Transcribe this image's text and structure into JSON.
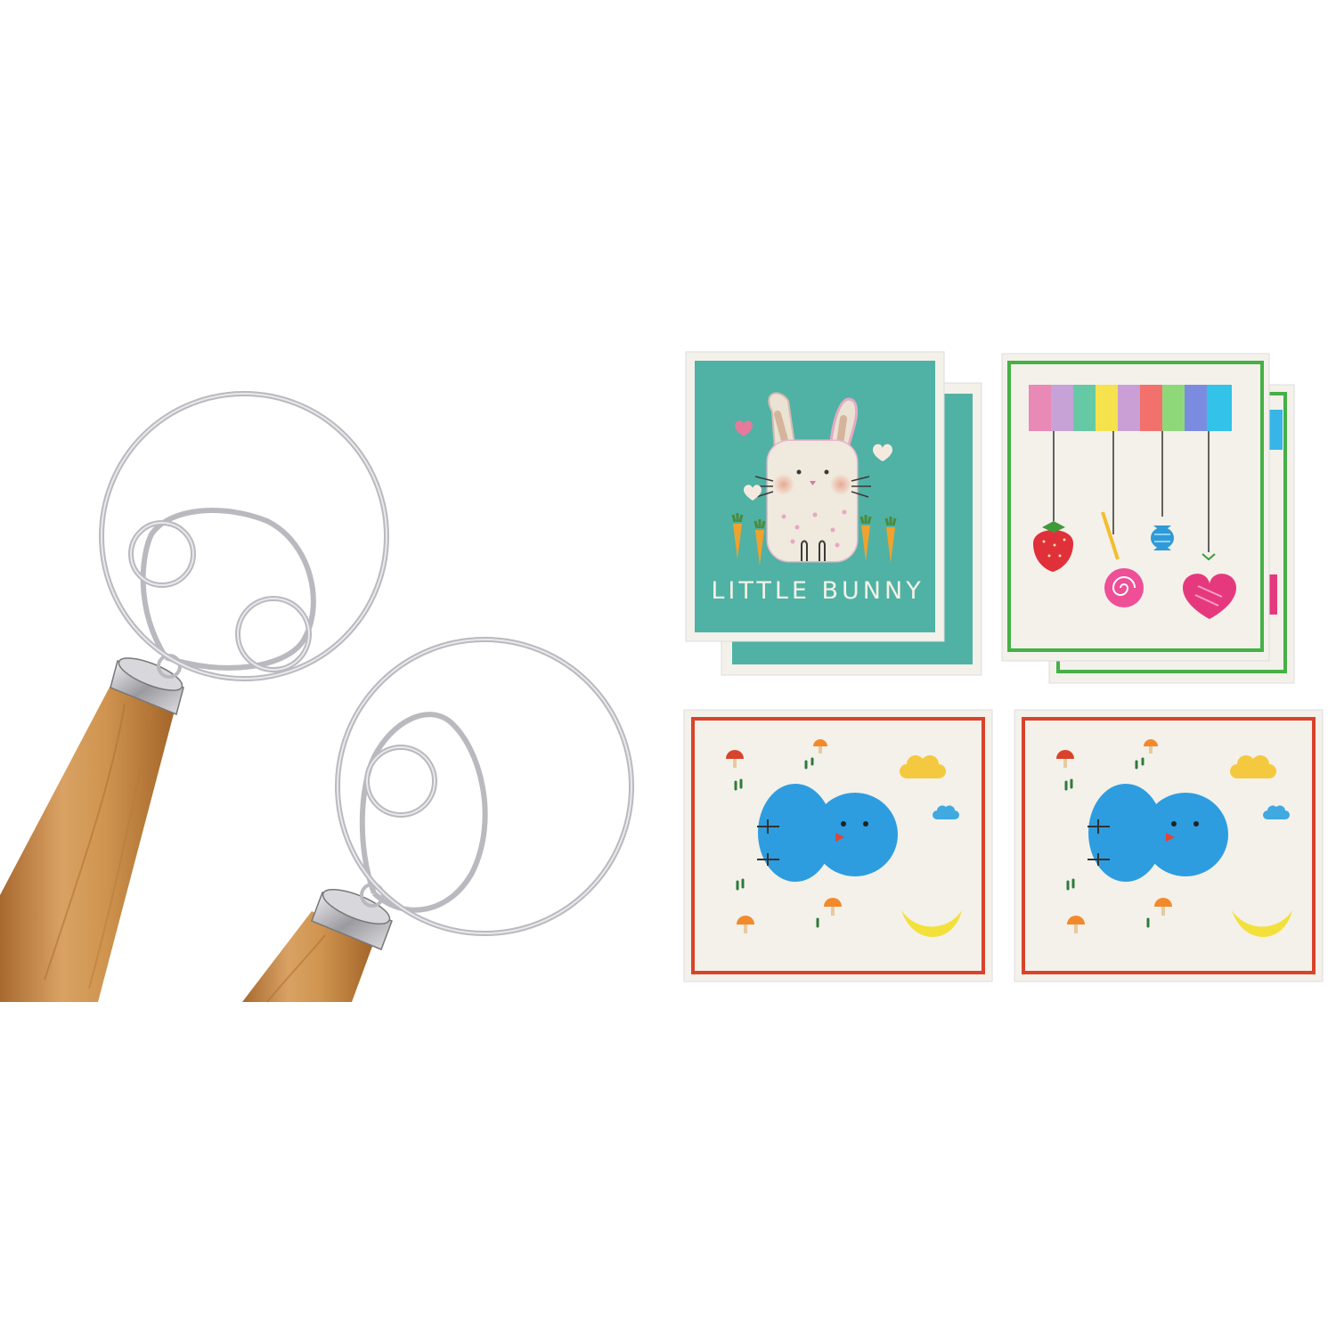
{
  "products": {
    "whisks": {
      "count": 2,
      "icon": "dough-whisk-icon"
    },
    "dishcloths": [
      {
        "design": "bunny",
        "label": "LITTLE BUNNY",
        "pack": 2
      },
      {
        "design": "hanging-candies",
        "pack": 2
      },
      {
        "design": "blue-bird"
      },
      {
        "design": "blue-bird"
      }
    ]
  },
  "colors": {
    "background": "#ffffff",
    "wood": "#c98f4e",
    "steel": "#c8c8cc",
    "bunny_cloth": "#4fb2a4",
    "candy_border": "#46b046",
    "bird_border": "#d9432b",
    "bird": "#2d9de0",
    "cloth_white": "#f3f1ea"
  }
}
